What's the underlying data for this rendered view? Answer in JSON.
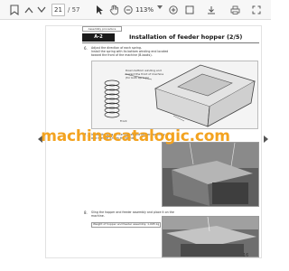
{
  "toolbar": {
    "page_current": "21",
    "page_total": "/ 57",
    "zoom_value": "113%"
  },
  "document": {
    "top_box_label": "Assembly procedure",
    "section_tag": "A-2",
    "title": "Installation of feeder hopper (2/5)",
    "page_number": "16",
    "steps": [
      {
        "num": "6.",
        "lines": [
          "Adjust the direction of each spring.",
          "Install the spring with its bottom winding end located",
          "toward the front of the machine (B-boots)."
        ]
      },
      {
        "num": "7.",
        "lines": [
          "Install the sling to the hopper and feeder assembly",
          "and remove it from the stand."
        ]
      },
      {
        "num": "8.",
        "lines": [
          "Sling the hopper and feeder assembly and place it on the",
          "machine."
        ]
      }
    ],
    "callout_spring": [
      "Down bottom winding end",
      "toward the front of machine",
      "(for both springs)"
    ],
    "callout_front": "Front",
    "callout_weight": "Weight of hopper and feeder assembly: 1,095 kg"
  },
  "watermark": "machinecatalogic.com",
  "colors": {
    "watermark": "#f3a320",
    "toolbar_bg": "#f7f7f7"
  }
}
